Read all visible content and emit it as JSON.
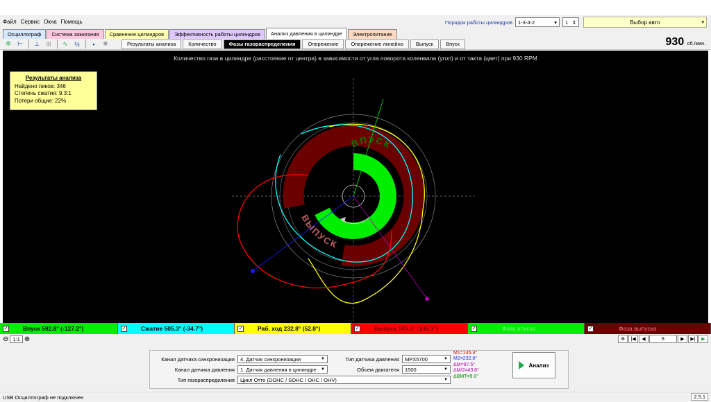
{
  "menu": [
    "Файл",
    "Сервис",
    "Окна",
    "Помощь"
  ],
  "cylinder_order": {
    "label": "Порядок работы цилиндров",
    "value": "1-3-4-2",
    "cylinder": "1"
  },
  "auto_select": "Выбор авто",
  "tabs": [
    {
      "label": "Осциллограф",
      "color": "#d7e9ff"
    },
    {
      "label": "Система зажигания",
      "color": "#ffc8e0"
    },
    {
      "label": "Сравнение цилиндров",
      "color": "#ffffb0"
    },
    {
      "label": "Эффективность работы цилиндров",
      "color": "#e0c8ff"
    },
    {
      "label": "Анализ давления в цилиндре",
      "color": "#ffffff"
    },
    {
      "label": "Электропитание",
      "color": "#ffd9c0"
    }
  ],
  "subtabs": [
    "Результаты анализа",
    "Количество",
    "Фазы газораспределения",
    "Опережение",
    "Опережение линейно",
    "Выпуск",
    "Впуск"
  ],
  "rpm": {
    "value": "930",
    "unit": "об./мин."
  },
  "chart": {
    "title": "Количество газа в цилиндре (расстояние от центра) в зависимости от угла поворота коленвала (угол) и от такта (цвет) при 930 RPM",
    "intake_label": "ВПУСК",
    "exhaust_label": "ВЫПУСК"
  },
  "results": {
    "heading": "Результаты анализа",
    "lines": [
      "Найдено пиков: 346",
      "Степень сжатия: 9.3:1",
      "Потери общие: 22%"
    ]
  },
  "legend": [
    {
      "label": "Впуск 592.8° (-127.2°)",
      "bg": "#00ee00",
      "fg": "#000",
      "w": 170
    },
    {
      "label": "Сжатие 505.3° (-34.7°)",
      "bg": "#00ffff",
      "fg": "#000",
      "w": 168
    },
    {
      "label": "Раб. ход 232.8° (52.8°)",
      "bg": "#ffff00",
      "fg": "#000",
      "w": 168
    },
    {
      "label": "Выпуск 145.3° (145.3°)",
      "bg": "#ff0000",
      "fg": "#7a0000",
      "w": 168
    },
    {
      "label": "Фаза впуска",
      "bg": "#00ee00",
      "fg": "#7dff7d",
      "w": 168
    },
    {
      "label": "Фаза выпуска",
      "bg": "#6b0000",
      "fg": "#e08080",
      "w": 174
    }
  ],
  "zoom": {
    "minus": "⊖",
    "ratio": "1:1",
    "plus": "⊕"
  },
  "nav": {
    "page": "8"
  },
  "panel": {
    "sync_label": "Канал датчика синхронизации",
    "sync_value": "4. Датчик синхронизации",
    "pressure_label": "Канал датчика давления",
    "pressure_value": "1. Датчик давления в цилиндре",
    "timing_label": "Тип газораспределения",
    "timing_value": "Цикл Отто (DOHC / SOHC / OHC / OHV)",
    "sensor_type_label": "Тип датчика давления",
    "sensor_type_value": "MPX5700",
    "volume_label": "Объем двигателя",
    "volume_value": "1500",
    "m_values": [
      {
        "text": "M1=145.3°",
        "color": "#d00000"
      },
      {
        "text": "M2=232.8°",
        "color": "#1a1aff"
      },
      {
        "text": "ΔM=87.5°",
        "color": "#b000b0"
      },
      {
        "text": "ΔM/2=43.8°",
        "color": "#b000b0"
      },
      {
        "text": "ΔВМТ=9.0°",
        "color": "#008000"
      }
    ],
    "analyze_label": "Анализ"
  },
  "status": {
    "usb": "USB Осциллограф не подключен",
    "version": "2.5.1"
  }
}
